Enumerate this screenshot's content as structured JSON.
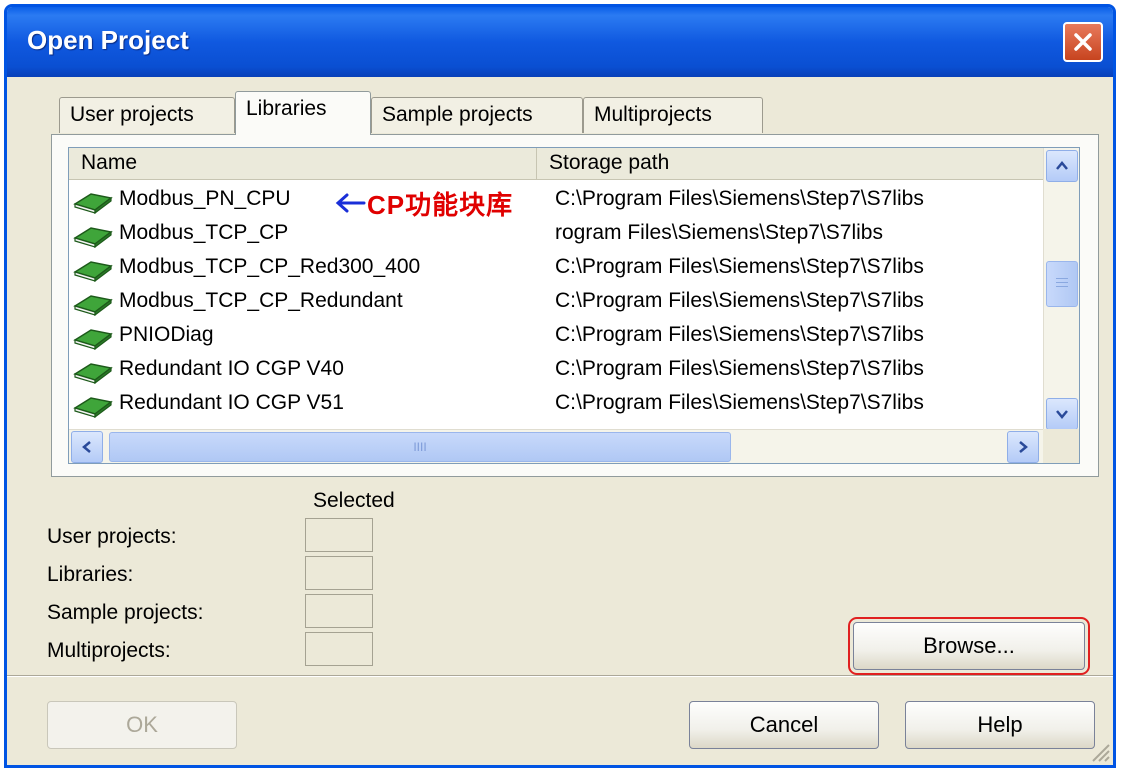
{
  "window": {
    "title": "Open Project"
  },
  "tabs": [
    {
      "label": "User projects"
    },
    {
      "label": "Libraries",
      "active": true
    },
    {
      "label": "Sample projects"
    },
    {
      "label": "Multiprojects"
    }
  ],
  "list": {
    "columns": [
      {
        "label": "Name"
      },
      {
        "label": "Storage path"
      }
    ],
    "rows": [
      {
        "name": "Modbus_PN_CPU",
        "path": "C:\\Program Files\\Siemens\\Step7\\S7libs"
      },
      {
        "name": "Modbus_TCP_CP",
        "path": "rogram Files\\Siemens\\Step7\\S7libs"
      },
      {
        "name": "Modbus_TCP_CP_Red300_400",
        "path": "C:\\Program Files\\Siemens\\Step7\\S7libs"
      },
      {
        "name": "Modbus_TCP_CP_Redundant",
        "path": "C:\\Program Files\\Siemens\\Step7\\S7libs"
      },
      {
        "name": "PNIODiag",
        "path": "C:\\Program Files\\Siemens\\Step7\\S7libs"
      },
      {
        "name": "Redundant IO CGP V40",
        "path": "C:\\Program Files\\Siemens\\Step7\\S7libs"
      },
      {
        "name": "Redundant IO CGP V51",
        "path": "C:\\Program Files\\Siemens\\Step7\\S7libs"
      }
    ],
    "row_icon": "green-book-icon"
  },
  "annotation": {
    "text": "CP功能块库",
    "color": "#e00000",
    "arrow_color": "#1a2fd8"
  },
  "selected": {
    "header": "Selected",
    "labels": {
      "user_projects": "User projects:",
      "libraries": "Libraries:",
      "sample_projects": "Sample projects:",
      "multiprojects": "Multiprojects:"
    }
  },
  "buttons": {
    "browse": "Browse...",
    "ok": "OK",
    "cancel": "Cancel",
    "help": "Help"
  },
  "colors": {
    "titlebar": "#0a4fd2",
    "dialog_bg": "#ece9d8",
    "highlight_border": "#e02020"
  }
}
